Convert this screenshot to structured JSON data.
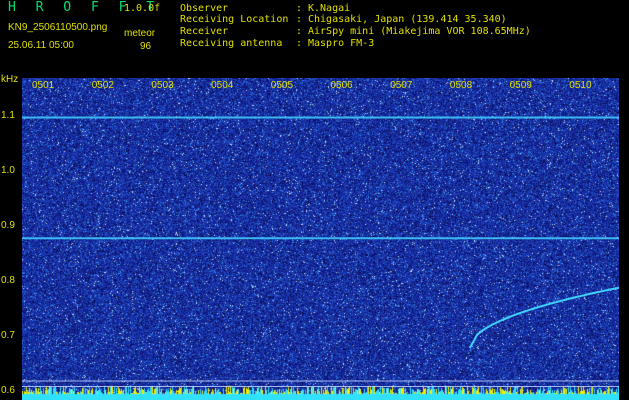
{
  "header": {
    "app_title": "H R O F F T",
    "version": "1.0.0f",
    "file_name": "KN9_2506110500.png",
    "timestamp": "25.06.11 05:00",
    "detect_label": "meteor",
    "detect_count": "96",
    "info": [
      {
        "key": "Observer",
        "value": "K.Nagai"
      },
      {
        "key": "Receiving Location",
        "value": "Chigasaki, Japan (139.414 35.340)"
      },
      {
        "key": "Receiver",
        "value": "AirSpy mini (Miakejima VOR 108.65MHz)"
      },
      {
        "key": "Receiving antenna",
        "value": "Maspro FM-3"
      }
    ],
    "separator": ":"
  },
  "chart_data": {
    "type": "heatmap",
    "ylabel": "kHz",
    "y_ticks": [
      "1.1",
      "1.0",
      "0.9",
      "0.8",
      "0.7",
      "0.6"
    ],
    "x_ticks": [
      "0501",
      "0502",
      "0503",
      "0504",
      "0505",
      "0506",
      "0507",
      "0508",
      "0509",
      "0510"
    ],
    "ylim": [
      0.6,
      1.15
    ],
    "xlim": [
      0,
      10
    ],
    "horizontal_lines_khz": [
      1.1,
      0.88,
      0.62,
      0.61
    ],
    "meteor_trail": {
      "x_start": 7.5,
      "x_end": 10,
      "y_start": 0.68,
      "y_end": 0.79
    },
    "colors": {
      "background": "#1a2aa0",
      "line": "#40d0ff",
      "baseline": "#ffff00",
      "text": "#e0e000"
    }
  }
}
